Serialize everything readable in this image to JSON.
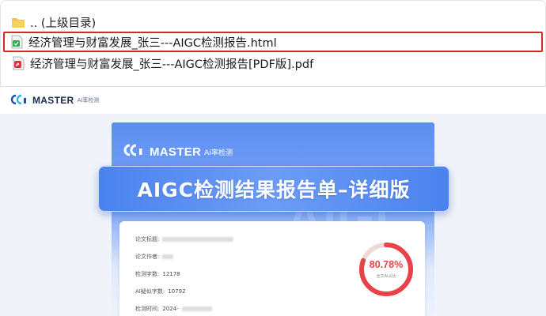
{
  "file_list": {
    "items": [
      {
        "label": ".. (上级目录)",
        "icon": "folder-icon"
      },
      {
        "label": "经济管理与财富发展_张三---AIGC检测报告.html",
        "icon": "html-file-icon",
        "selected": true
      },
      {
        "label": "经济管理与财富发展_张三---AIGC检测报告[PDF版].pdf",
        "icon": "pdf-file-icon"
      }
    ]
  },
  "brand": {
    "name": "MASTER",
    "sub": "AI率检测"
  },
  "banner": {
    "title": "AIGC检测结果报告单–详细版"
  },
  "report": {
    "ghost_text": "AIGC",
    "fields": [
      {
        "label": "论文标题:",
        "value": ""
      },
      {
        "label": "论文作者:",
        "value": ""
      },
      {
        "label": "检测字数:",
        "value": "12178"
      },
      {
        "label": "AI疑似字数:",
        "value": "10792"
      },
      {
        "label": "检测时间:",
        "value": "2024-"
      }
    ],
    "score": "80.78%",
    "score_label": "全文AI占比",
    "score_fraction": 0.8078
  },
  "colors": {
    "accent": "#4a82ef",
    "highlight": "#d8262b",
    "score": "#e8434a"
  }
}
